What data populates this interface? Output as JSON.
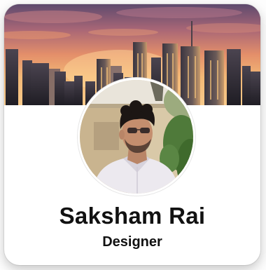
{
  "profile": {
    "name": "Saksham Rai",
    "role": "Designer"
  },
  "images": {
    "cover": "city-skyline-sunset",
    "avatar": "profile-photo"
  },
  "colors": {
    "card_background": "#ffffff",
    "text": "#111111",
    "avatar_ring": "#ffffff"
  }
}
